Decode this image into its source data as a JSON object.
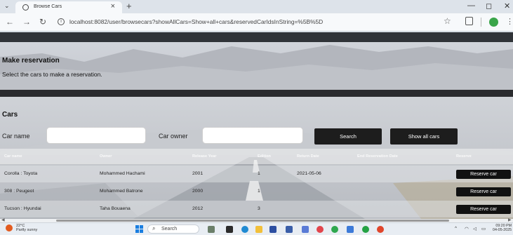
{
  "browser": {
    "tab_title": "Browse Cars",
    "url": "localhost:8082/user/browsecars?showAllCars=Show+all+cars&reservedCarIdsInString=%5B%5D",
    "icons": [
      "tab-list-icon",
      "favicon-icon",
      "close-icon",
      "new-tab-icon",
      "minimize-icon",
      "maximize-icon",
      "window-close-icon",
      "back-icon",
      "forward-icon",
      "reload-icon",
      "site-info-icon",
      "bookmark-star-icon",
      "extensions-icon",
      "profile-icon",
      "menu-icon"
    ]
  },
  "page": {
    "reservation_title": "Make reservation",
    "reservation_subtitle": "Select the cars to make a reservation.",
    "cars_title": "Cars",
    "search": {
      "car_name_label": "Car name",
      "car_name_value": "",
      "car_owner_label": "Car owner",
      "car_owner_value": "",
      "search_button": "Search",
      "show_all_button": "Show all cars"
    },
    "table": {
      "headers": [
        "Car name",
        "Owner",
        "Release Year",
        "Edition",
        "Return Date",
        "End Reservation Date",
        "Reserve"
      ],
      "rows": [
        {
          "car": "Corolla : Toyota",
          "owner": "Mohammed Hachami",
          "year": "2001",
          "edition": "1",
          "return_date": "2021-05-06",
          "end_date": "",
          "action": "Reserve car"
        },
        {
          "car": "308 : Peugeot",
          "owner": "Mohammed Batrone",
          "year": "2000",
          "edition": "1",
          "return_date": "",
          "end_date": "",
          "action": "Reserve car"
        },
        {
          "car": "Tucson : Hyundai",
          "owner": "Taha Bouaena",
          "year": "2012",
          "edition": "3",
          "return_date": "",
          "end_date": "",
          "action": "Reserve car"
        }
      ]
    },
    "colors": {
      "button_bg": "#1d1d1d",
      "button_text": "#ffffff",
      "dark_band": "#1e1e1e"
    }
  },
  "taskbar": {
    "weather_temp": "22°C",
    "weather_desc": "Partly sunny",
    "search_placeholder": "Search",
    "clock_time": "09:20 PM",
    "clock_date": "04-05-2025"
  }
}
